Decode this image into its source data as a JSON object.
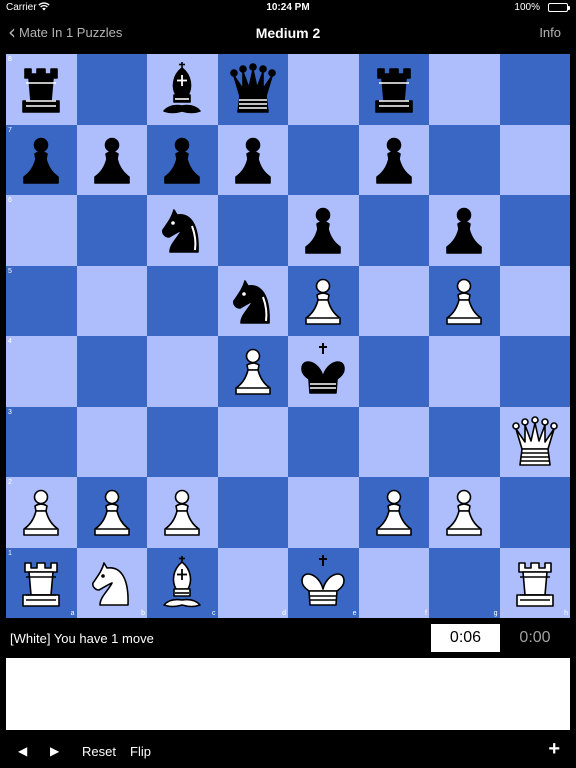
{
  "status_bar": {
    "carrier": "Carrier",
    "time": "10:24 PM",
    "battery": "100%"
  },
  "nav": {
    "back_label": "Mate In 1 Puzzles",
    "title": "Medium 2",
    "info_label": "Info"
  },
  "board": {
    "light_color": "#aebefc",
    "dark_color": "#3b67c4",
    "ranks": [
      "8",
      "7",
      "6",
      "5",
      "4",
      "3",
      "2",
      "1"
    ],
    "files": [
      "a",
      "b",
      "c",
      "d",
      "e",
      "f",
      "g",
      "h"
    ],
    "pieces": [
      {
        "square": "a8",
        "color": "black",
        "type": "rook"
      },
      {
        "square": "c8",
        "color": "black",
        "type": "bishop"
      },
      {
        "square": "d8",
        "color": "black",
        "type": "queen"
      },
      {
        "square": "f8",
        "color": "black",
        "type": "rook"
      },
      {
        "square": "a7",
        "color": "black",
        "type": "pawn"
      },
      {
        "square": "b7",
        "color": "black",
        "type": "pawn"
      },
      {
        "square": "c7",
        "color": "black",
        "type": "pawn"
      },
      {
        "square": "d7",
        "color": "black",
        "type": "pawn"
      },
      {
        "square": "f7",
        "color": "black",
        "type": "pawn"
      },
      {
        "square": "c6",
        "color": "black",
        "type": "knight"
      },
      {
        "square": "e6",
        "color": "black",
        "type": "pawn"
      },
      {
        "square": "g6",
        "color": "black",
        "type": "pawn"
      },
      {
        "square": "d5",
        "color": "black",
        "type": "knight"
      },
      {
        "square": "e5",
        "color": "white",
        "type": "pawn"
      },
      {
        "square": "g5",
        "color": "white",
        "type": "pawn"
      },
      {
        "square": "d4",
        "color": "white",
        "type": "pawn"
      },
      {
        "square": "e4",
        "color": "black",
        "type": "king"
      },
      {
        "square": "h3",
        "color": "white",
        "type": "queen"
      },
      {
        "square": "a2",
        "color": "white",
        "type": "pawn"
      },
      {
        "square": "b2",
        "color": "white",
        "type": "pawn"
      },
      {
        "square": "c2",
        "color": "white",
        "type": "pawn"
      },
      {
        "square": "f2",
        "color": "white",
        "type": "pawn"
      },
      {
        "square": "g2",
        "color": "white",
        "type": "pawn"
      },
      {
        "square": "a1",
        "color": "white",
        "type": "rook"
      },
      {
        "square": "b1",
        "color": "white",
        "type": "knight"
      },
      {
        "square": "c1",
        "color": "white",
        "type": "bishop"
      },
      {
        "square": "e1",
        "color": "white",
        "type": "king"
      },
      {
        "square": "h1",
        "color": "white",
        "type": "rook"
      }
    ]
  },
  "game": {
    "move_text": "[White] You have 1 move",
    "white_timer": "0:06",
    "black_timer": "0:00"
  },
  "toolbar": {
    "prev_icon": "◀",
    "next_icon": "▶",
    "reset_label": "Reset",
    "flip_label": "Flip",
    "add_icon": "+"
  }
}
